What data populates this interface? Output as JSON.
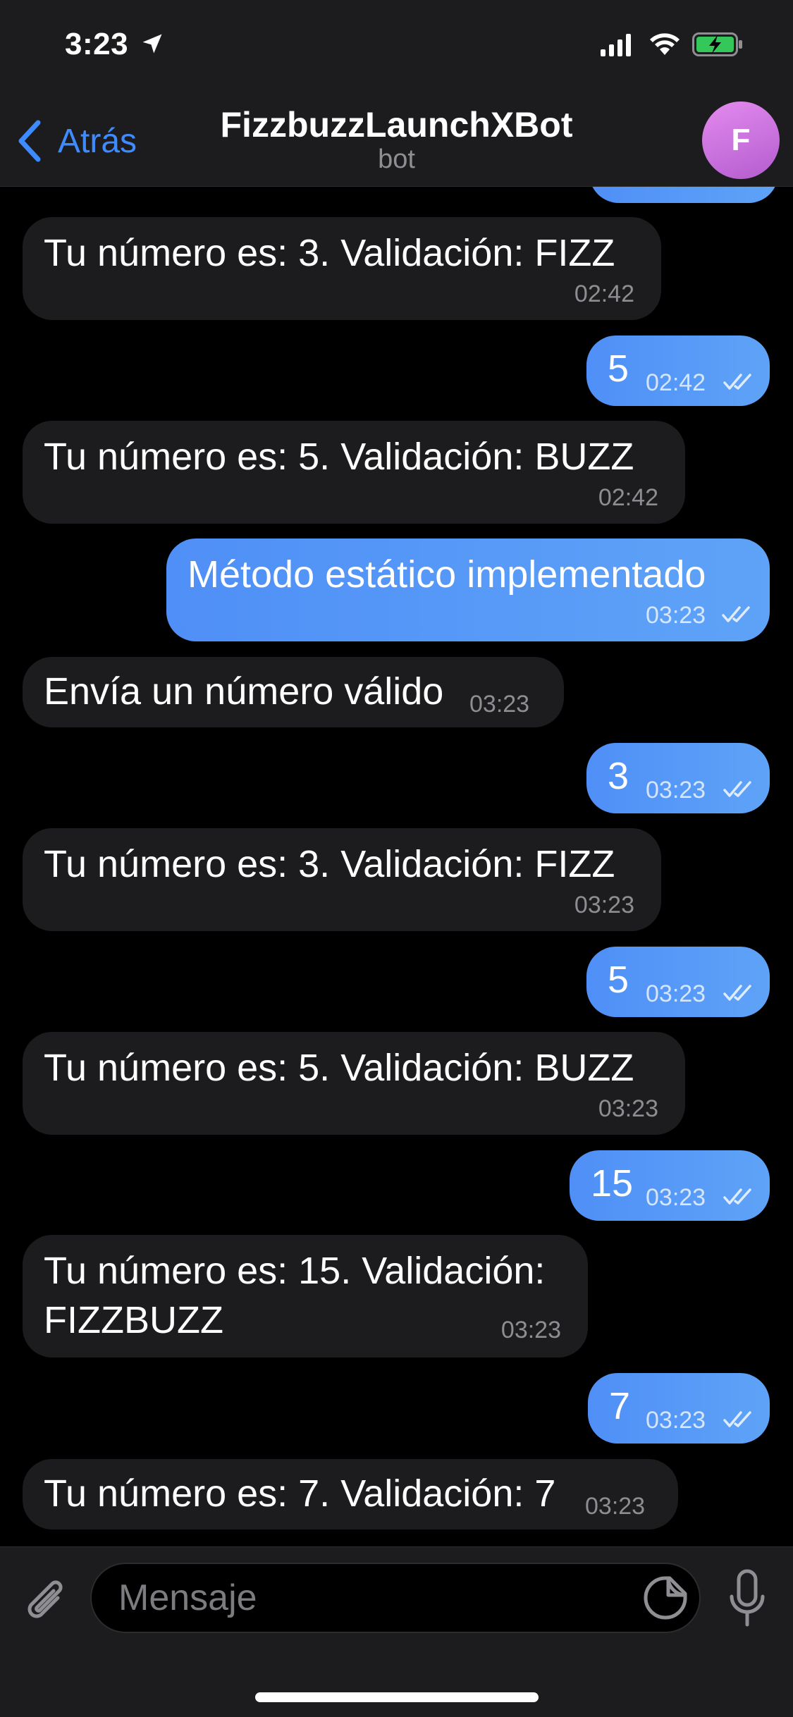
{
  "status_bar": {
    "time": "3:23"
  },
  "header": {
    "back_label": "Atrás",
    "title": "FizzbuzzLaunchXBot",
    "subtitle": "bot",
    "avatar_letter": "F"
  },
  "messages": [
    {
      "dir": "in",
      "text": "Tu número es: 3. Validación: FIZZ",
      "time": "02:42"
    },
    {
      "dir": "out",
      "text": "5",
      "time": "02:42"
    },
    {
      "dir": "in",
      "text": "Tu número es: 5. Validación: BUZZ",
      "time": "02:42"
    },
    {
      "dir": "out",
      "text": "Método estático implementado",
      "time": "03:23"
    },
    {
      "dir": "in",
      "text": "Envía un número válido",
      "time": "03:23"
    },
    {
      "dir": "out",
      "text": "3",
      "time": "03:23"
    },
    {
      "dir": "in",
      "text": "Tu número es: 3. Validación: FIZZ",
      "time": "03:23"
    },
    {
      "dir": "out",
      "text": "5",
      "time": "03:23"
    },
    {
      "dir": "in",
      "text": "Tu número es: 5. Validación: BUZZ",
      "time": "03:23"
    },
    {
      "dir": "out",
      "text": "15",
      "time": "03:23"
    },
    {
      "dir": "in",
      "text_line1": "Tu número es: 15. Validación:",
      "text_line2": "FIZZBUZZ",
      "time": "03:23"
    },
    {
      "dir": "out",
      "text": "7",
      "time": "03:23"
    },
    {
      "dir": "in",
      "text": "Tu número es: 7. Validación: 7",
      "time": "03:23"
    }
  ],
  "composer": {
    "placeholder": "Mensaje"
  },
  "colors": {
    "accent": "#3e8bff",
    "outgoing_bubble": "#5ea3f7",
    "incoming_bubble": "#1c1c1e"
  },
  "icons": [
    "location-arrow-icon",
    "signal-icon",
    "wifi-icon",
    "battery-charging-icon",
    "chevron-left-icon",
    "paperclip-icon",
    "sticker-icon",
    "microphone-icon",
    "double-check-icon"
  ]
}
